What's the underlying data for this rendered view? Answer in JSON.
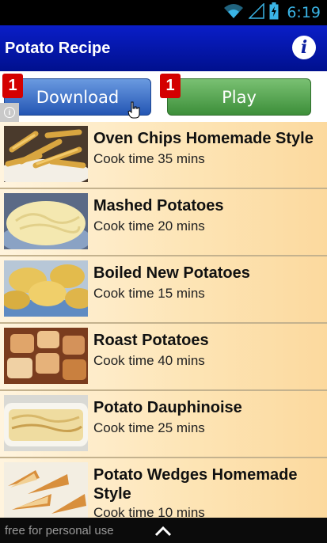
{
  "status_bar": {
    "time": "6:19",
    "icons": [
      "wifi-icon",
      "signal-icon",
      "battery-icon"
    ]
  },
  "app_bar": {
    "title": "Potato Recipe",
    "info_icon": "info-icon"
  },
  "ad": {
    "download_label": "Download",
    "play_label": "Play",
    "download_badge": "1",
    "play_badge": "1",
    "info_icon": "ad-info-icon"
  },
  "recipes": [
    {
      "name": "Oven Chips Homemade Style",
      "cook_time": "Cook time 35 mins"
    },
    {
      "name": "Mashed Potatoes",
      "cook_time": "Cook time 20 mins"
    },
    {
      "name": "Boiled New Potatoes",
      "cook_time": "Cook time 15 mins"
    },
    {
      "name": "Roast Potatoes",
      "cook_time": "Cook time 40 mins"
    },
    {
      "name": "Potato Dauphinoise",
      "cook_time": "Cook time 25 mins"
    },
    {
      "name": "Potato Wedges Homemade Style",
      "cook_time": "Cook time 10 mins"
    }
  ],
  "bottom_bar": {
    "note": "free for personal use",
    "icon": "chevron-up-icon"
  },
  "colors": {
    "app_bar": "#00108e",
    "list_bg": "#fde0ae",
    "status_icons": "#3ab4e6"
  }
}
